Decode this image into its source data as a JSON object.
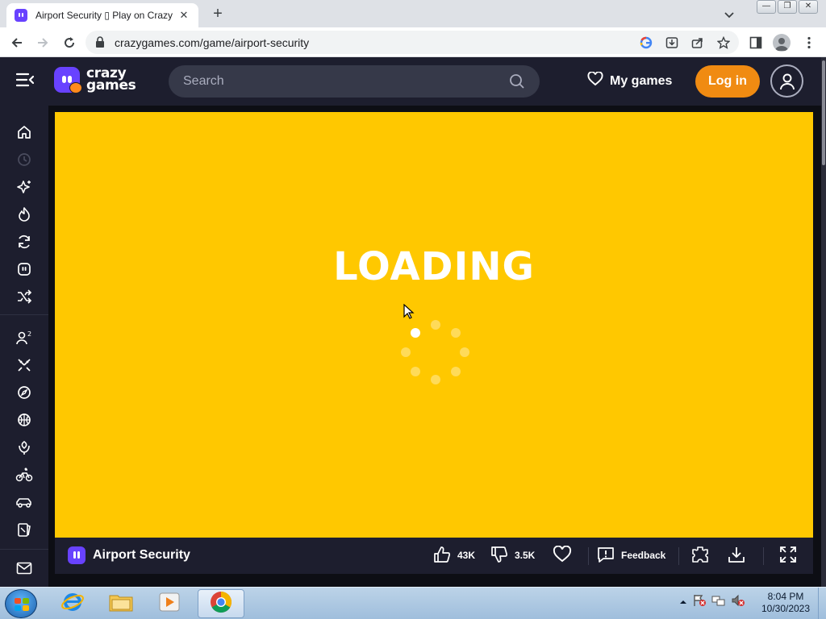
{
  "browser": {
    "tab_title": "Airport Security ▯ Play on CrazyG",
    "url": "crazygames.com/game/airport-security",
    "new_tab_symbol": "+",
    "close_symbol": "✕"
  },
  "site": {
    "logo_line1": "crazy",
    "logo_line2": "games",
    "search_placeholder": "Search",
    "my_games_label": "My games",
    "login_label": "Log in"
  },
  "sidebar": {
    "icons": [
      "home-icon",
      "recent-icon",
      "new-icon",
      "trending-icon",
      "updated-icon",
      "originals-icon",
      "random-icon",
      "multiplayer-icon",
      "action-icon",
      "adventure-icon",
      "basketball-icon",
      "beauty-icon",
      "bike-icon",
      "car-icon",
      "card-icon",
      "mail-icon"
    ]
  },
  "game": {
    "loading_text": "LOADING",
    "background_color": "#ffc800",
    "title": "Airport Security",
    "likes": "43K",
    "dislikes": "3.5K",
    "feedback_label": "Feedback"
  },
  "taskbar": {
    "time": "8:04 PM",
    "date": "10/30/2023"
  },
  "colors": {
    "brand_purple": "#6842ff",
    "login_orange": "#f08b12",
    "header_dark": "#1d1e2e"
  }
}
